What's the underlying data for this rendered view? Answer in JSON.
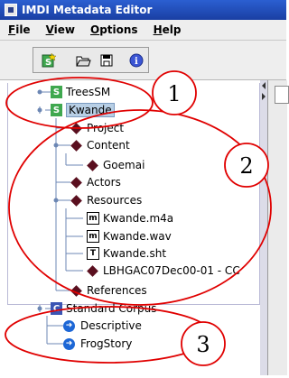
{
  "window": {
    "title": "IMDI Metadata Editor"
  },
  "menu": [
    "File",
    "View",
    "Options",
    "Help"
  ],
  "toolbar": {
    "buttons": [
      "new-session",
      "open-folder",
      "save",
      "info"
    ]
  },
  "tree": {
    "nodes": [
      {
        "label": "TreesSM",
        "icon": "session-s-icon"
      },
      {
        "label": "Kwande",
        "icon": "session-s-icon",
        "selected": true
      },
      {
        "label": "Project",
        "icon": "diamond-icon"
      },
      {
        "label": "Content",
        "icon": "diamond-icon"
      },
      {
        "label": "Goemai",
        "icon": "diamond-icon"
      },
      {
        "label": "Actors",
        "icon": "diamond-icon"
      },
      {
        "label": "Resources",
        "icon": "diamond-icon"
      },
      {
        "label": "Kwande.m4a",
        "icon": "media-m-icon"
      },
      {
        "label": "Kwande.wav",
        "icon": "media-m-icon"
      },
      {
        "label": "Kwande.sht",
        "icon": "text-t-icon"
      },
      {
        "label": "LBHGAC07Dec00-01 - CC",
        "icon": "diamond-icon"
      },
      {
        "label": "References",
        "icon": "diamond-icon"
      },
      {
        "label": "Standard Corpus",
        "icon": "corpus-c-icon"
      },
      {
        "label": "Descriptive",
        "icon": "link-arrow-icon"
      },
      {
        "label": "FrogStory",
        "icon": "link-arrow-icon"
      }
    ]
  },
  "glyphs": {
    "session": "S",
    "corpus": "C",
    "media": "m",
    "text": "T",
    "arrow": "➜"
  },
  "annotations": [
    "1",
    "2",
    "3"
  ],
  "colors": {
    "annotation": "#e00000",
    "selection": "#b8cfe5",
    "diamond": "#5a0f1f",
    "title_bar": "#2b5fd1"
  }
}
